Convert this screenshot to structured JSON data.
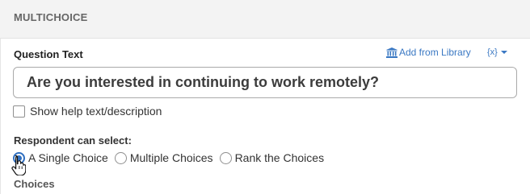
{
  "header": {
    "title": "MULTICHOICE"
  },
  "question": {
    "label": "Question Text",
    "value": "Are you interested in continuing to work remotely?",
    "add_from_library": "Add from Library",
    "variable_button": "{x}"
  },
  "help_option": {
    "label": "Show help text/description",
    "checked": false
  },
  "respondent": {
    "label": "Respondent can select:",
    "options": [
      {
        "label": "A Single Choice",
        "checked": true
      },
      {
        "label": "Multiple Choices",
        "checked": false
      },
      {
        "label": "Rank the Choices",
        "checked": false
      }
    ]
  },
  "choices": {
    "label": "Choices"
  },
  "colors": {
    "accent": "#3a78c3",
    "radio": "#2f6fc0",
    "header_bg": "#f3f3f3"
  },
  "icons": {
    "library": "bank-icon",
    "caret": "caret-down-icon",
    "cursor": "hand-pointer-icon"
  }
}
